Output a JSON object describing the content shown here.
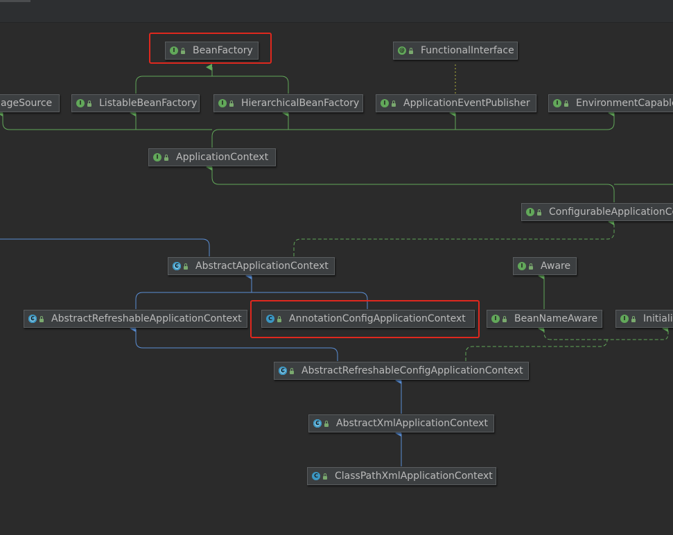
{
  "nodes": {
    "beanfactory": {
      "label": "BeanFactory",
      "kind": "interface",
      "badge": "I"
    },
    "functionalinterface": {
      "label": "FunctionalInterface",
      "kind": "annotation",
      "badge": "@"
    },
    "messagesource": {
      "label": "ageSource",
      "kind": "interface",
      "badge": "I"
    },
    "listablebeanfactory": {
      "label": "ListableBeanFactory",
      "kind": "interface",
      "badge": "I"
    },
    "hierarchicalbeanfactory": {
      "label": "HierarchicalBeanFactory",
      "kind": "interface",
      "badge": "I"
    },
    "applicationeventpublisher": {
      "label": "ApplicationEventPublisher",
      "kind": "interface",
      "badge": "I"
    },
    "environmentcapable": {
      "label": "EnvironmentCapable",
      "kind": "interface",
      "badge": "I"
    },
    "applicationcontext": {
      "label": "ApplicationContext",
      "kind": "interface",
      "badge": "I"
    },
    "configurableapplicationcontext": {
      "label": "ConfigurableApplicationCo",
      "kind": "interface",
      "badge": "I"
    },
    "abstractapplicationcontext": {
      "label": "AbstractApplicationContext",
      "kind": "abstract",
      "badge": "C"
    },
    "aware": {
      "label": "Aware",
      "kind": "interface",
      "badge": "I"
    },
    "abstractrefreshableapplicationcontext": {
      "label": "AbstractRefreshableApplicationContext",
      "kind": "abstract",
      "badge": "C"
    },
    "annotationconfigapplicationcontext": {
      "label": "AnnotationConfigApplicationContext",
      "kind": "class",
      "badge": "C"
    },
    "beannameaware": {
      "label": "BeanNameAware",
      "kind": "interface",
      "badge": "I"
    },
    "initializingbean": {
      "label": "Initiali",
      "kind": "interface",
      "badge": "I"
    },
    "abstractrefreshableconfigapplicationcontext": {
      "label": "AbstractRefreshableConfigApplicationContext",
      "kind": "abstract",
      "badge": "C"
    },
    "abstractxmlapplicationcontext": {
      "label": "AbstractXmlApplicationContext",
      "kind": "abstract",
      "badge": "C"
    },
    "classpathxmlapplicationcontext": {
      "label": "ClassPathXmlApplicationContext",
      "kind": "class",
      "badge": "C"
    }
  },
  "colors": {
    "background": "#2b2b2b",
    "interface_edge": "#62a85a",
    "class_edge": "#5b8fd6",
    "annotation_edge": "#b5b53c",
    "highlight": "#e0281e"
  },
  "highlighted": [
    "beanfactory",
    "annotationconfigapplicationcontext"
  ]
}
